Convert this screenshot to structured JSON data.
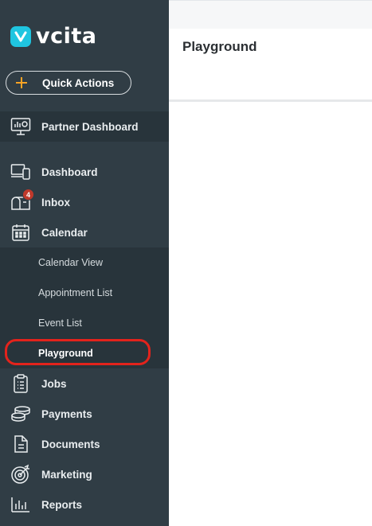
{
  "brand": {
    "name": "vcita"
  },
  "sidebar": {
    "quick_actions_label": "Quick Actions",
    "partner_label": "Partner Dashboard",
    "items": [
      {
        "label": "Dashboard",
        "icon": "devices-icon"
      },
      {
        "label": "Inbox",
        "icon": "mailbox-icon",
        "badge": "4"
      },
      {
        "label": "Calendar",
        "icon": "calendar-icon"
      },
      {
        "label": "Jobs",
        "icon": "clipboard-icon"
      },
      {
        "label": "Payments",
        "icon": "coins-icon"
      },
      {
        "label": "Documents",
        "icon": "document-icon"
      },
      {
        "label": "Marketing",
        "icon": "target-icon"
      },
      {
        "label": "Reports",
        "icon": "bar-chart-icon"
      }
    ],
    "calendar_subitems": [
      {
        "label": "Calendar View"
      },
      {
        "label": "Appointment List"
      },
      {
        "label": "Event List"
      },
      {
        "label": "Playground",
        "active": true
      }
    ]
  },
  "main": {
    "title": "Playground"
  },
  "colors": {
    "sidebar_bg": "#303d45",
    "submenu_bg": "#28343b",
    "accent_orange": "#f7a425",
    "brand_cyan": "#1fc5e0",
    "highlight_red": "#e3231c",
    "badge_red": "#c0392b"
  }
}
